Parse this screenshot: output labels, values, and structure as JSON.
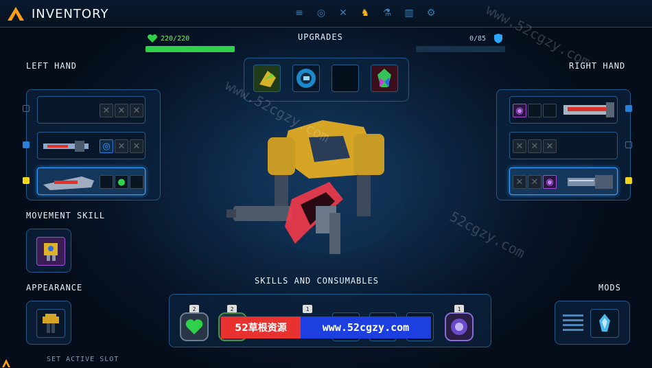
{
  "header": {
    "title": "INVENTORY",
    "tabs": [
      {
        "icon": "database-icon",
        "glyph": "≡"
      },
      {
        "icon": "globe-icon",
        "glyph": "◎"
      },
      {
        "icon": "crossed-weapons-icon",
        "glyph": "✕"
      },
      {
        "icon": "mech-icon",
        "glyph": "♞",
        "active": true
      },
      {
        "icon": "flask-icon",
        "glyph": "⚗"
      },
      {
        "icon": "stats-icon",
        "glyph": "▥"
      },
      {
        "icon": "settings-gear-icon",
        "glyph": "⚙"
      }
    ]
  },
  "stats": {
    "health": "220/220",
    "health_fraction": 1.0,
    "shield": "0/85",
    "shield_fraction": 0.0
  },
  "upgrades": {
    "label": "UPGRADES"
  },
  "left_hand": {
    "label": "LEFT HAND"
  },
  "right_hand": {
    "label": "RIGHT HAND"
  },
  "movement_skill": {
    "label": "MOVEMENT SKILL"
  },
  "appearance": {
    "label": "APPEARANCE"
  },
  "skills": {
    "label": "SKILLS AND CONSUMABLES",
    "counts": [
      "2",
      "2",
      "1",
      "1"
    ]
  },
  "mods": {
    "label": "MODS"
  },
  "footer": {
    "hint": "SET ACTIVE SLOT"
  },
  "watermark": {
    "text": "www.52cgzy.com",
    "site": "52cgzy.com"
  },
  "banner": {
    "left": "52草根资源",
    "right": "www.52cgzy.com"
  },
  "colors": {
    "accent": "#ffb41f",
    "health": "#2fd14a",
    "shield": "#2aa6ff",
    "slot_border": "#1f5d8d"
  }
}
